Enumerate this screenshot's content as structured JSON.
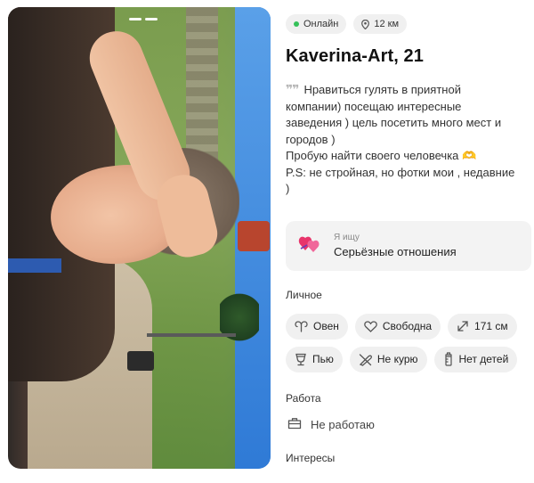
{
  "status": {
    "online": "Онлайн",
    "distance": "12 км"
  },
  "profile": {
    "name": "Kaverina-Art, 21",
    "bio_lines": [
      "Нравиться гулять в приятной",
      "компании) посещаю интересные",
      "заведения ) цель посетить много мест и",
      "городов )",
      "Пробую найти своего человечка 🫶",
      "P.S: не стройная, но фотки мои , недавние",
      ")"
    ]
  },
  "seeking": {
    "label": "Я ищу",
    "value": "Серьёзные отношения"
  },
  "personal": {
    "title": "Личное",
    "tags": [
      {
        "icon": "aries-icon",
        "label": "Овен"
      },
      {
        "icon": "heart-icon",
        "label": "Свободна"
      },
      {
        "icon": "height-icon",
        "label": "171 см"
      },
      {
        "icon": "drink-icon",
        "label": "Пью"
      },
      {
        "icon": "no-smoking-icon",
        "label": "Не курю"
      },
      {
        "icon": "baby-bottle-icon",
        "label": "Нет детей"
      }
    ]
  },
  "work": {
    "title": "Работа",
    "value": "Не работаю"
  },
  "interests": {
    "title": "Интересы"
  },
  "colors": {
    "online": "#35c15a",
    "chip_bg": "#f0f0f0",
    "card_bg": "#f3f3f3"
  }
}
